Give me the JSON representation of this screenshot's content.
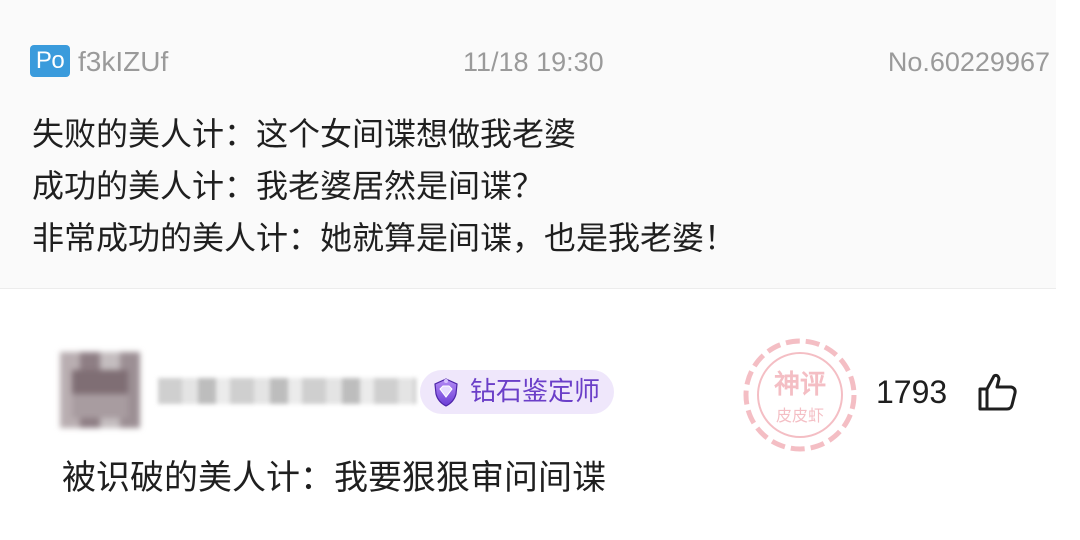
{
  "post": {
    "badge": "Po",
    "username": "f3kIZUf",
    "time": "11/18 19:30",
    "number": "No.60229967",
    "lines": [
      "失败的美人计：这个女间谍想做我老婆",
      "成功的美人计：我老婆居然是间谍？",
      "非常成功的美人计：她就算是间谍，也是我老婆！"
    ]
  },
  "comment": {
    "level_badge": "钻石鉴定师",
    "level_icon": "diamond-shield-icon",
    "like_count": "1793",
    "like_icon": "thumbs-up-icon",
    "text": "被识破的美人计：我要狠狠审问间谍",
    "watermark": {
      "top": "神评",
      "bottom": "皮皮虾",
      "color": "#e0485a"
    }
  },
  "colors": {
    "badge_blue": "#3a9bdc",
    "meta_gray": "#9a9a9a",
    "level_purple": "#6b3fc8"
  }
}
